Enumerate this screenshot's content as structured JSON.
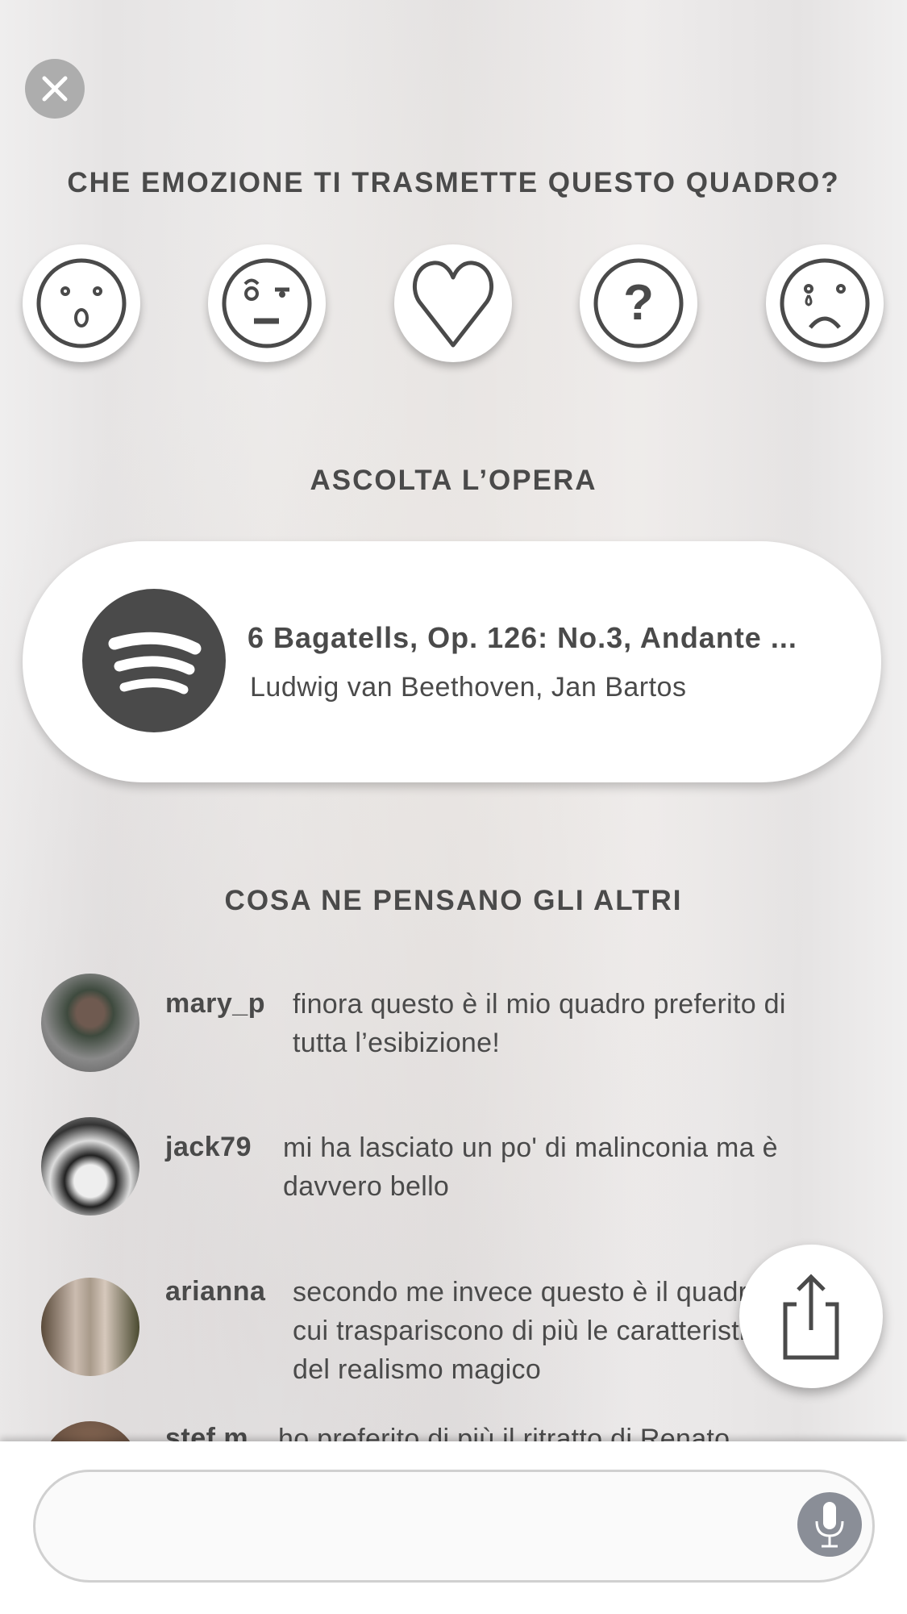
{
  "close_icon": "close-icon",
  "emotion": {
    "title": "CHE EMOZIONE TI TRASMETTE QUESTO QUADRO?",
    "options": [
      {
        "icon": "surprised-face-icon"
      },
      {
        "icon": "skeptical-face-icon"
      },
      {
        "icon": "heart-icon"
      },
      {
        "icon": "question-icon"
      },
      {
        "icon": "crying-face-icon"
      }
    ]
  },
  "listen": {
    "title": "ASCOLTA L’OPERA",
    "service_icon": "spotify-icon",
    "track": "6 Bagatells, Op. 126: No.3, Andante ...",
    "artist": "Ludwig van Beethoven, Jan Bartos"
  },
  "comments": {
    "title": "COSA NE PENSANO GLI ALTRI",
    "items": [
      {
        "user": "mary_p",
        "line1": "finora questo è il mio quadro preferito di",
        "line2": "tutta l’esibizione!"
      },
      {
        "user": "jack79",
        "line1": "mi ha lasciato un po' di malinconia ma è",
        "line2": "davvero bello"
      },
      {
        "user": "arianna",
        "line1": "secondo me invece questo è il quadro in",
        "line2": "cui traspariscono di più le caratteristiche",
        "line3": "del realismo magico"
      },
      {
        "user": "stef.m",
        "line1": "ho preferito di più il ritratto di Renato"
      }
    ]
  },
  "share_icon": "share-icon",
  "composer": {
    "value": "",
    "placeholder": "",
    "mic_icon": "microphone-icon"
  },
  "colors": {
    "text": "#4a4a4a",
    "mic": "#8a8e97",
    "close": "#adadad"
  }
}
